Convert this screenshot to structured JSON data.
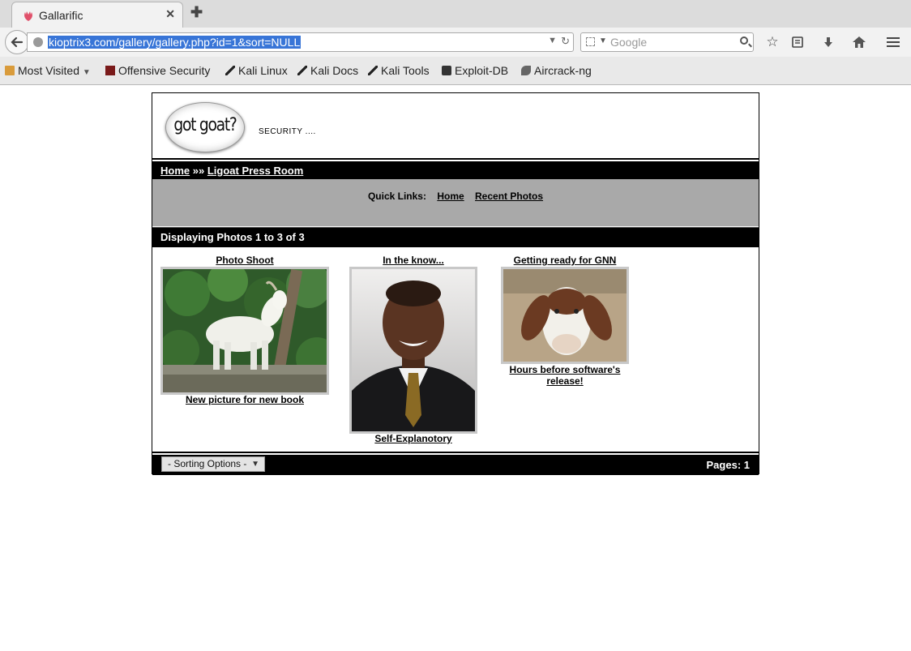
{
  "browser": {
    "tab_title": "Gallarific",
    "url": "kioptrix3.com/gallery/gallery.php?id=1&sort=NULL",
    "search_placeholder": "Google",
    "bookmarks": [
      "Most Visited",
      "Offensive Security",
      "Kali Linux",
      "Kali Docs",
      "Kali Tools",
      "Exploit-DB",
      "Aircrack-ng"
    ]
  },
  "header": {
    "logo_text": "got goat?",
    "tagline": "SECURITY ...."
  },
  "breadcrumb": {
    "home": "Home",
    "separator": "»»",
    "current": "Ligoat Press Room"
  },
  "quick_links": {
    "label": "Quick Links:",
    "home": "Home",
    "recent": "Recent Photos"
  },
  "display_text": "Displaying Photos 1 to 3 of 3",
  "photos": [
    {
      "title": "Photo Shoot",
      "caption": "New picture for new book"
    },
    {
      "title": "In the know...",
      "caption": "Self-Explanotory"
    },
    {
      "title": "Getting ready for GNN",
      "caption": "Hours before software's release!"
    }
  ],
  "footer": {
    "sort_label": "- Sorting Options -",
    "pages_text": "Pages: 1"
  }
}
